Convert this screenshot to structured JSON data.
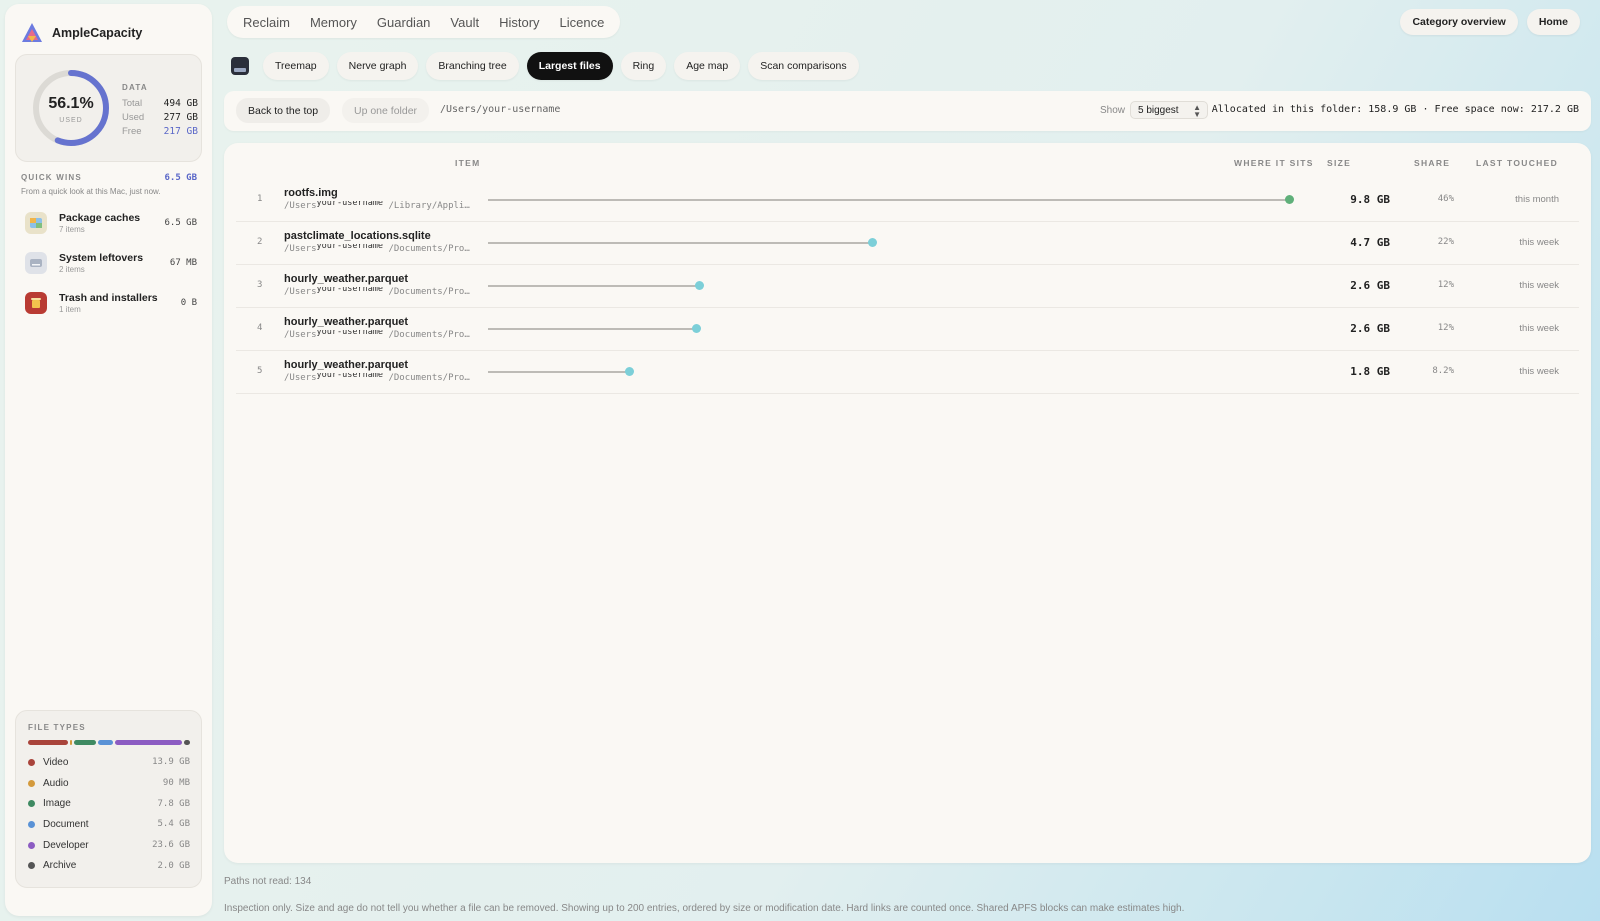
{
  "app": {
    "name": "AmpleCapacity"
  },
  "usage": {
    "percent": "56.1%",
    "percent_value": 0.561,
    "sub": "USED",
    "data_header": "DATA",
    "rows": [
      {
        "label": "Total",
        "value": "494 GB"
      },
      {
        "label": "Used",
        "value": "277 GB"
      },
      {
        "label": "Free",
        "value": "217 GB"
      }
    ]
  },
  "quick_wins": {
    "title": "QUICK WINS",
    "total": "6.5 GB",
    "description": "From a quick look at this Mac, just now.",
    "items": [
      {
        "name": "Package caches",
        "sub": "7 items",
        "size": "6.5 GB",
        "icon": "package-icon"
      },
      {
        "name": "System leftovers",
        "sub": "2 items",
        "size": "67 MB",
        "icon": "drive-icon"
      },
      {
        "name": "Trash and installers",
        "sub": "1 item",
        "size": "0 B",
        "icon": "trash-icon"
      }
    ]
  },
  "file_types": {
    "title": "FILE TYPES",
    "items": [
      {
        "name": "Video",
        "value": "13.9 GB",
        "color": "#a9443b",
        "share": 0.264
      },
      {
        "name": "Audio",
        "value": "90 MB",
        "color": "#d49a3c",
        "share": 0.002
      },
      {
        "name": "Image",
        "value": "7.8 GB",
        "color": "#3f8a62",
        "share": 0.148
      },
      {
        "name": "Document",
        "value": "5.4 GB",
        "color": "#5a92d6",
        "share": 0.102
      },
      {
        "name": "Developer",
        "value": "23.6 GB",
        "color": "#8c5cc2",
        "share": 0.448
      },
      {
        "name": "Archive",
        "value": "2.0 GB",
        "color": "#555555",
        "share": 0.038
      }
    ]
  },
  "topnav": [
    "Reclaim",
    "Memory",
    "Guardian",
    "Vault",
    "History",
    "Licence"
  ],
  "top_right": {
    "category_overview": "Category overview",
    "home": "Home"
  },
  "subtabs": [
    {
      "label": "Treemap",
      "active": false
    },
    {
      "label": "Nerve graph",
      "active": false
    },
    {
      "label": "Branching tree",
      "active": false
    },
    {
      "label": "Largest files",
      "active": true
    },
    {
      "label": "Ring",
      "active": false
    },
    {
      "label": "Age map",
      "active": false
    },
    {
      "label": "Scan comparisons",
      "active": false
    }
  ],
  "pathbar": {
    "back": "Back to the top",
    "up": "Up one folder",
    "path": "/Users/your-username",
    "show_label": "Show",
    "show_value": "5 biggest",
    "summary": "Allocated in this folder: 158.9 GB · Free space now: 217.2 GB"
  },
  "table": {
    "headers": {
      "item": "ITEM",
      "where": "WHERE IT SITS",
      "size": "SIZE",
      "share": "SHARE",
      "touched": "LAST TOUCHED"
    },
    "rows": [
      {
        "idx": "1",
        "name": "rootfs.img",
        "path_prefix": "/Users",
        "user": "your-username",
        "path_suffix": "/Library/Appli…",
        "size": "9.8 GB",
        "share": "46%",
        "touched": "this month",
        "fraction": 1.0,
        "color": "#5fb07a"
      },
      {
        "idx": "2",
        "name": "pastclimate_locations.sqlite",
        "path_prefix": "/Users",
        "user": "your-username",
        "path_suffix": "/Documents/Pro…",
        "size": "4.7 GB",
        "share": "22%",
        "touched": "this week",
        "fraction": 0.48,
        "color": "#7ccfd8"
      },
      {
        "idx": "3",
        "name": "hourly_weather.parquet",
        "path_prefix": "/Users",
        "user": "your-username",
        "path_suffix": "/Documents/Pro…",
        "size": "2.6 GB",
        "share": "12%",
        "touched": "this week",
        "fraction": 0.264,
        "color": "#7ccfd8"
      },
      {
        "idx": "4",
        "name": "hourly_weather.parquet",
        "path_prefix": "/Users",
        "user": "your-username",
        "path_suffix": "/Documents/Pro…",
        "size": "2.6 GB",
        "share": "12%",
        "touched": "this week",
        "fraction": 0.26,
        "color": "#7ccfd8"
      },
      {
        "idx": "5",
        "name": "hourly_weather.parquet",
        "path_prefix": "/Users",
        "user": "your-username",
        "path_suffix": "/Documents/Pro…",
        "size": "1.8 GB",
        "share": "8.2%",
        "touched": "this week",
        "fraction": 0.176,
        "color": "#7ccfd8"
      }
    ]
  },
  "footer": {
    "paths_not_read": "Paths not read: 134",
    "note": "Inspection only. Size and age do not tell you whether a file can be removed. Showing up to 200 entries, ordered by size or modification date. Hard links are counted once. Shared APFS blocks can make estimates high."
  }
}
